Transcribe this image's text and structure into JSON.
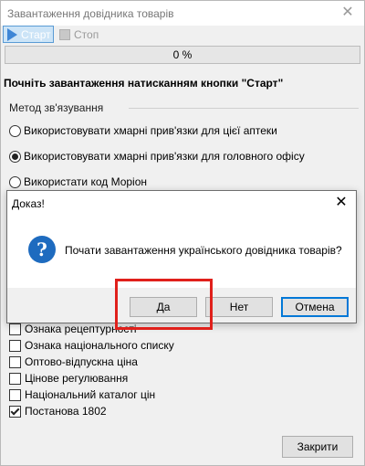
{
  "window": {
    "title": "Завантаження довідника товарів"
  },
  "toolbar": {
    "start_label": "Старт",
    "stop_label": "Стоп"
  },
  "progress": {
    "text": "0 %",
    "value": 0
  },
  "main": {
    "heading": "Почніть завантаження натисканням кнопки \"Старт\"",
    "group_label": "Метод зв'язування",
    "radios": [
      {
        "label": "Використовувати хмарні прив'язки для цієї аптеки",
        "checked": false
      },
      {
        "label": "Використовувати хмарні прив'язки для головного офісу",
        "checked": true
      },
      {
        "label": "Використати код Моріон",
        "checked": false
      }
    ],
    "checkboxes": [
      {
        "label": "Ознака рецептурності",
        "checked": false
      },
      {
        "label": "Ознака національного списку",
        "checked": false
      },
      {
        "label": "Оптово-відпускна ціна",
        "checked": false
      },
      {
        "label": "Цінове регулювання",
        "checked": false
      },
      {
        "label": "Національний каталог цін",
        "checked": false
      },
      {
        "label": "Постанова 1802",
        "checked": true
      }
    ],
    "close_label": "Закрити"
  },
  "dialog": {
    "title": "Доказ!",
    "message": "Почати завантаження українського довідника товарів?",
    "yes_label": "Да",
    "no_label": "Нет",
    "cancel_label": "Отмена"
  },
  "colors": {
    "accent": "#0078d7",
    "highlight": "#e0201b",
    "info_icon": "#1e6bbf"
  }
}
